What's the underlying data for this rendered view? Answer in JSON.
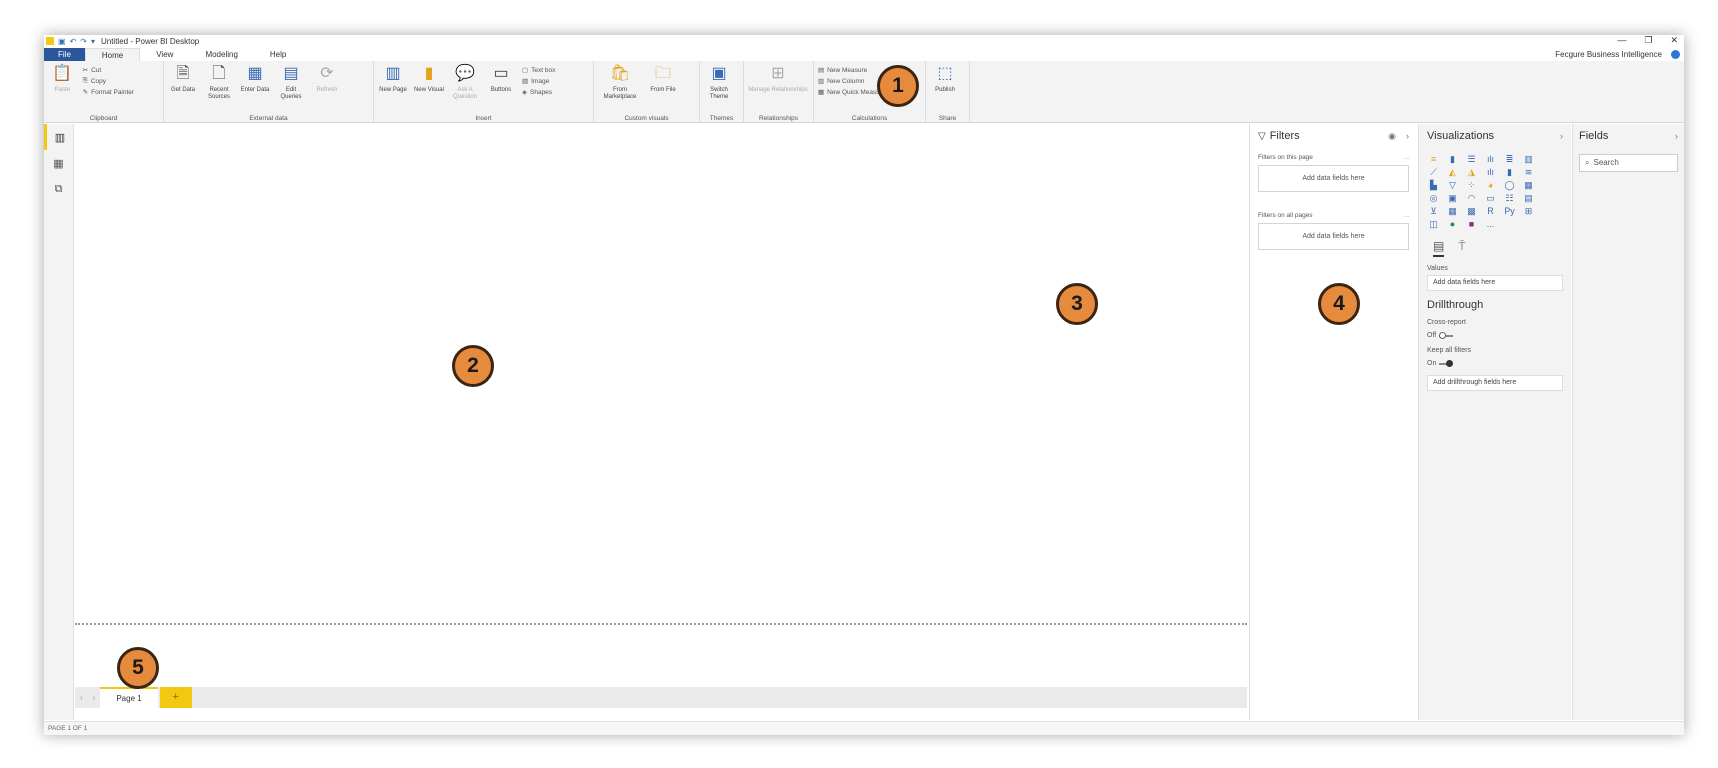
{
  "title_bar": {
    "title": "Untitled - Power BI Desktop"
  },
  "menu_tabs": [
    {
      "label": "File"
    },
    {
      "label": "Home"
    },
    {
      "label": "View"
    },
    {
      "label": "Modeling"
    },
    {
      "label": "Help"
    }
  ],
  "account": {
    "label": "Fecgure Business Intelligence"
  },
  "ribbon": {
    "clipboard": {
      "paste": "Paste",
      "cut": "Cut",
      "copy": "Copy",
      "format_painter": "Format Painter",
      "group": "Clipboard"
    },
    "external_data": {
      "get_data": "Get Data",
      "recent_sources": "Recent Sources",
      "enter_data": "Enter Data",
      "edit_queries": "Edit Queries",
      "refresh": "Refresh",
      "group": "External data"
    },
    "insert": {
      "new_page": "New Page",
      "new_visual": "New Visual",
      "ask_question": "Ask A Question",
      "buttons": "Buttons",
      "text_box": "Text box",
      "image": "Image",
      "shapes": "Shapes",
      "group": "Insert"
    },
    "custom_visuals": {
      "from_marketplace": "From Marketplace",
      "from_file": "From File",
      "group": "Custom visuals"
    },
    "themes": {
      "switch_theme": "Switch Theme",
      "group": "Themes"
    },
    "relationships": {
      "manage": "Manage Relationships",
      "group": "Relationships"
    },
    "calculations": {
      "new_measure": "New Measure",
      "new_column": "New Column",
      "new_quick_measure": "New Quick Measure",
      "group": "Calculations"
    },
    "share": {
      "publish": "Publish",
      "group": "Share"
    }
  },
  "page_tabs": {
    "page1": "Page 1",
    "add": "+"
  },
  "status_bar": {
    "text": "PAGE 1 OF 1"
  },
  "filters_pane": {
    "title": "Filters",
    "on_this_page": "Filters on this page",
    "on_all_pages": "Filters on all pages",
    "add_fields": "Add data fields here",
    "dots": "..."
  },
  "viz_pane": {
    "title": "Visualizations",
    "values_label": "Values",
    "values_placeholder": "Add data fields here",
    "drillthrough_title": "Drillthrough",
    "cross_report": "Cross-report",
    "off": "Off",
    "keep_all_filters": "Keep all filters",
    "on": "On",
    "drill_placeholder": "Add drillthrough fields here",
    "more": "..."
  },
  "fields_pane": {
    "title": "Fields",
    "search_placeholder": "Search"
  },
  "callouts": {
    "c1": "1",
    "c2": "2",
    "c3": "3",
    "c4": "4",
    "c5": "5"
  },
  "colors": {
    "accent": "#f2c811",
    "file_tab": "#2b579a",
    "callout": "#e68a3e"
  }
}
